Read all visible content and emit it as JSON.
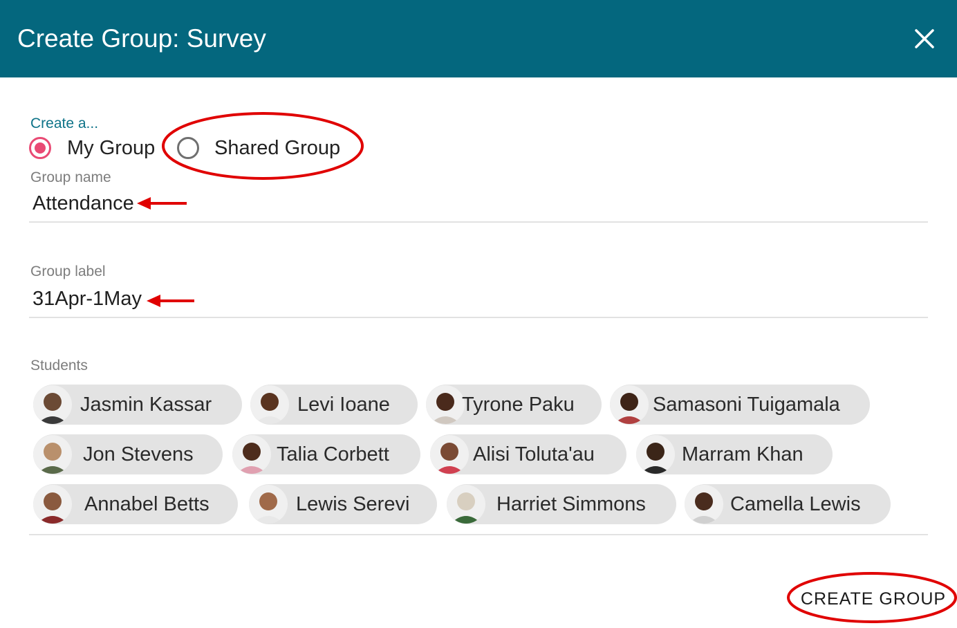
{
  "dialog": {
    "title": "Create Group: Survey",
    "close_icon": "close-icon"
  },
  "group_type": {
    "label": "Create a...",
    "options": [
      {
        "label": "My Group",
        "selected": true
      },
      {
        "label": "Shared Group",
        "selected": false
      }
    ]
  },
  "group_name": {
    "label": "Group name",
    "value": "Attendance"
  },
  "group_label": {
    "label": "Group label",
    "value": "31Apr-1May"
  },
  "students": {
    "label": "Students",
    "chips": [
      {
        "name": "Jasmin Kassar",
        "avatar_color": "#6b4a35"
      },
      {
        "name": "Levi Ioane",
        "avatar_color": "#5a3420"
      },
      {
        "name": "Tyrone Paku",
        "avatar_color": "#4a2a1c"
      },
      {
        "name": "Samasoni Tuigamala",
        "avatar_color": "#3e2417"
      },
      {
        "name": "Jon Stevens",
        "avatar_color": "#b9906c"
      },
      {
        "name": "Talia Corbett",
        "avatar_color": "#4d2c1c"
      },
      {
        "name": "Alisi Toluta'au",
        "avatar_color": "#7a4a34"
      },
      {
        "name": "Marram Khan",
        "avatar_color": "#3b2518"
      },
      {
        "name": "Annabel Betts",
        "avatar_color": "#8a5a3f"
      },
      {
        "name": "Lewis Serevi",
        "avatar_color": "#a06a4a"
      },
      {
        "name": "Harriet Simmons",
        "avatar_color": "#d8cfc0"
      },
      {
        "name": "Camella Lewis",
        "avatar_color": "#4a2c1e"
      }
    ]
  },
  "actions": {
    "create_label": "CREATE GROUP"
  },
  "colors": {
    "header": "#04677e",
    "accent": "#e94a74",
    "chip_bg": "#e3e3e3",
    "annotation": "#e00000"
  }
}
